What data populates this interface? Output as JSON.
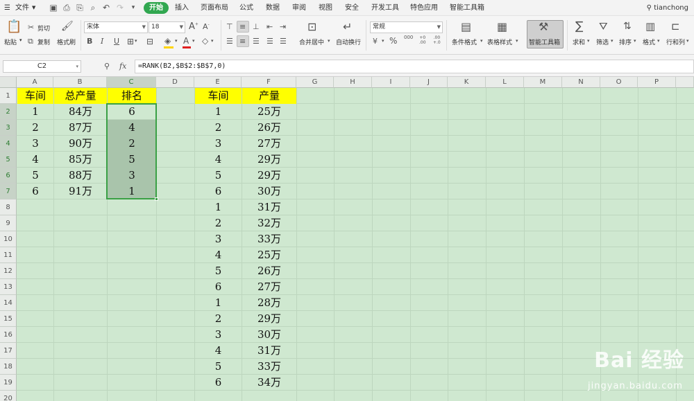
{
  "menubar": {
    "app_menu": "文件",
    "tabs": [
      "开始",
      "插入",
      "页面布局",
      "公式",
      "数据",
      "审阅",
      "视图",
      "安全",
      "开发工具",
      "特色应用",
      "智能工具箱"
    ],
    "active_tab": "开始",
    "user": "tianchong"
  },
  "ribbon": {
    "paste": "粘贴",
    "cut": "剪切",
    "copy": "复制",
    "format_painter": "格式刷",
    "font_name": "宋体",
    "font_size": "18",
    "merge_center": "合并居中",
    "wrap_text": "自动换行",
    "number_format": "常规",
    "conditional_format": "条件格式",
    "table_style": "表格样式",
    "smart_toolbox": "智能工具箱",
    "sum": "求和",
    "filter": "筛选",
    "sort": "排序",
    "format": "格式",
    "row_col": "行和列",
    "percent": "%",
    "thousands": "000",
    "inc_decimal": "+0\n.00",
    "dec_decimal": ".00\n+.0"
  },
  "formula_bar": {
    "cell_ref": "C2",
    "fx_label": "fx",
    "formula": "=RANK(B2,$B$2:$B$7,0)"
  },
  "sheet": {
    "columns": [
      "A",
      "B",
      "C",
      "D",
      "E",
      "F",
      "G",
      "H",
      "I",
      "J",
      "K",
      "L",
      "M",
      "N",
      "O",
      "P"
    ],
    "rows": [
      "1",
      "2",
      "3",
      "4",
      "5",
      "6",
      "7",
      "8",
      "9",
      "10",
      "11",
      "12",
      "13",
      "14",
      "15",
      "16",
      "17",
      "18",
      "19",
      "20"
    ],
    "left_headers": [
      "车间",
      "总产量",
      "排名"
    ],
    "left_rows": [
      [
        "1",
        "84万",
        "6"
      ],
      [
        "2",
        "87万",
        "4"
      ],
      [
        "3",
        "90万",
        "2"
      ],
      [
        "4",
        "85万",
        "5"
      ],
      [
        "5",
        "88万",
        "3"
      ],
      [
        "6",
        "91万",
        "1"
      ]
    ],
    "right_headers": [
      "车间",
      "产量"
    ],
    "right_rows": [
      [
        "1",
        "25万"
      ],
      [
        "2",
        "26万"
      ],
      [
        "3",
        "27万"
      ],
      [
        "4",
        "29万"
      ],
      [
        "5",
        "29万"
      ],
      [
        "6",
        "30万"
      ],
      [
        "1",
        "31万"
      ],
      [
        "2",
        "32万"
      ],
      [
        "3",
        "33万"
      ],
      [
        "4",
        "25万"
      ],
      [
        "5",
        "26万"
      ],
      [
        "6",
        "27万"
      ],
      [
        "1",
        "28万"
      ],
      [
        "2",
        "29万"
      ],
      [
        "3",
        "30万"
      ],
      [
        "4",
        "31万"
      ],
      [
        "5",
        "33万"
      ],
      [
        "6",
        "34万"
      ]
    ],
    "selected_column": "C",
    "selected_rows": [
      "2",
      "3",
      "4",
      "5",
      "6",
      "7"
    ]
  },
  "watermark": {
    "brand": "Bai 经验",
    "url": "jingyan.baidu.com"
  },
  "colors": {
    "header_fill": "#ffff00",
    "grid_background": "#cfe8d0",
    "selection_border": "#3aa045",
    "active_tab": "#31a750"
  }
}
